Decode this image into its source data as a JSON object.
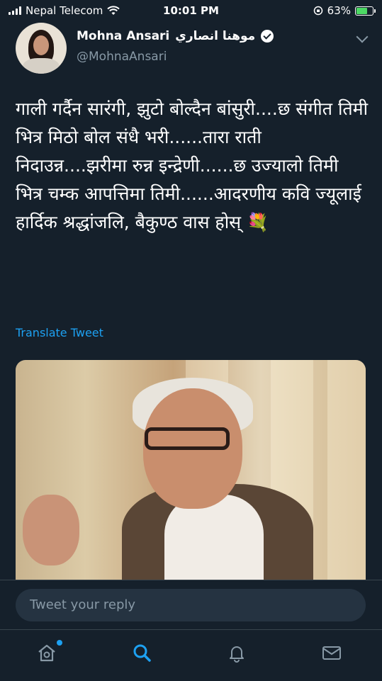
{
  "status_bar": {
    "carrier": "Nepal Telecom",
    "time": "10:01 PM",
    "battery": "63%",
    "battery_level": 0.63
  },
  "tweet": {
    "author_name": "Mohna Ansari",
    "author_name_arabic": "موهنا انصاري",
    "handle": "@MohnaAnsari",
    "text": "गाली गर्दैन सारंगी, झुटो बोल्दैन बांसुरी....छ संगीत तिमी भित्र मिठो बोल संधै भरी......तारा राती निदाउन्न....झरीमा रुन्न इन्द्रेणी......छ उज्यालो तिमी भित्र चम्क आपत्तिमा तिमी......आदरणीय कवि ज्यूलाई हार्दिक श्रद्धांजलि, बैकुण्ठ वास होस् 💐",
    "translate_label": "Translate Tweet"
  },
  "reply": {
    "placeholder": "Tweet your reply"
  },
  "tabs": [
    {
      "icon": "home-icon"
    },
    {
      "icon": "search-icon"
    },
    {
      "icon": "bell-icon"
    },
    {
      "icon": "mail-icon"
    }
  ],
  "colors": {
    "background": "#15202b",
    "accent": "#1da1f2",
    "secondary_text": "#8899a6"
  }
}
